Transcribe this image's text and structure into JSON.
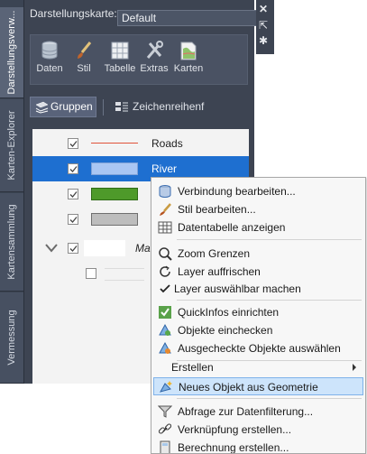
{
  "vertical_tabs": [
    "Darstellungsverw...",
    "Karten-Explorer",
    "Kartensammlung",
    "Vermessung"
  ],
  "palette": {
    "map_label": "Darstellungskarte:",
    "map_value": "Default",
    "toolbar": [
      {
        "label": "Daten",
        "icon": "database-icon"
      },
      {
        "label": "Stil",
        "icon": "brush-icon"
      },
      {
        "label": "Tabelle",
        "icon": "table-icon"
      },
      {
        "label": "Extras",
        "icon": "tools-icon"
      },
      {
        "label": "Karten",
        "icon": "map-icon"
      }
    ],
    "groups_label": "Gruppen",
    "draw_order_label": "Zeichenreihenf",
    "layers": [
      {
        "name": "Roads",
        "checked": true,
        "style": "line",
        "color": "#e0533a"
      },
      {
        "name": "River",
        "checked": true,
        "style": "fill",
        "color": "#a9c6f3",
        "selected": true
      },
      {
        "name": "",
        "checked": true,
        "style": "fill",
        "color": "#4e9a2a"
      },
      {
        "name": "",
        "checked": true,
        "style": "fill",
        "color": "#bdbdbd"
      },
      {
        "name": "Ma",
        "checked": true,
        "style": "group"
      },
      {
        "name": "",
        "checked": false,
        "style": "blank"
      }
    ]
  },
  "side_buttons": [
    "close-icon",
    "pin-icon",
    "settings-icon"
  ],
  "context_menu": {
    "items": [
      {
        "label": "Verbindung bearbeiten...",
        "icon": "database-icon",
        "underline": "V"
      },
      {
        "label": "Stil bearbeiten...",
        "icon": "brush-icon",
        "underline": "S"
      },
      {
        "label": "Datentabelle anzeigen",
        "icon": "table-icon",
        "underline": "D"
      },
      {
        "label": "Zoom Grenzen",
        "icon": "zoom-icon",
        "underline": "Z"
      },
      {
        "label": "Layer auffrischen",
        "icon": "refresh-icon",
        "underline": "L"
      },
      {
        "label": "Layer auswählbar machen",
        "icon": "check-icon",
        "underline": ""
      },
      {
        "label": "QuickInfos einrichten",
        "icon": "quickinfo-icon",
        "underline": "Q"
      },
      {
        "label": "Objekte einchecken",
        "icon": "checkin-icon",
        "underline": ""
      },
      {
        "label": "Ausgecheckte Objekte auswählen",
        "icon": "checkout-select-icon",
        "underline": ""
      },
      {
        "label": "Erstellen",
        "icon": "",
        "submenu": true
      },
      {
        "label": "Neues Objekt aus Geometrie",
        "icon": "new-object-icon",
        "highlighted": true
      },
      {
        "label": "Abfrage zur Datenfilterung...",
        "icon": "filter-icon"
      },
      {
        "label": "Verknüpfung erstellen...",
        "icon": "link-icon"
      },
      {
        "label": "Berechnung erstellen...",
        "icon": "calc-icon"
      }
    ]
  }
}
